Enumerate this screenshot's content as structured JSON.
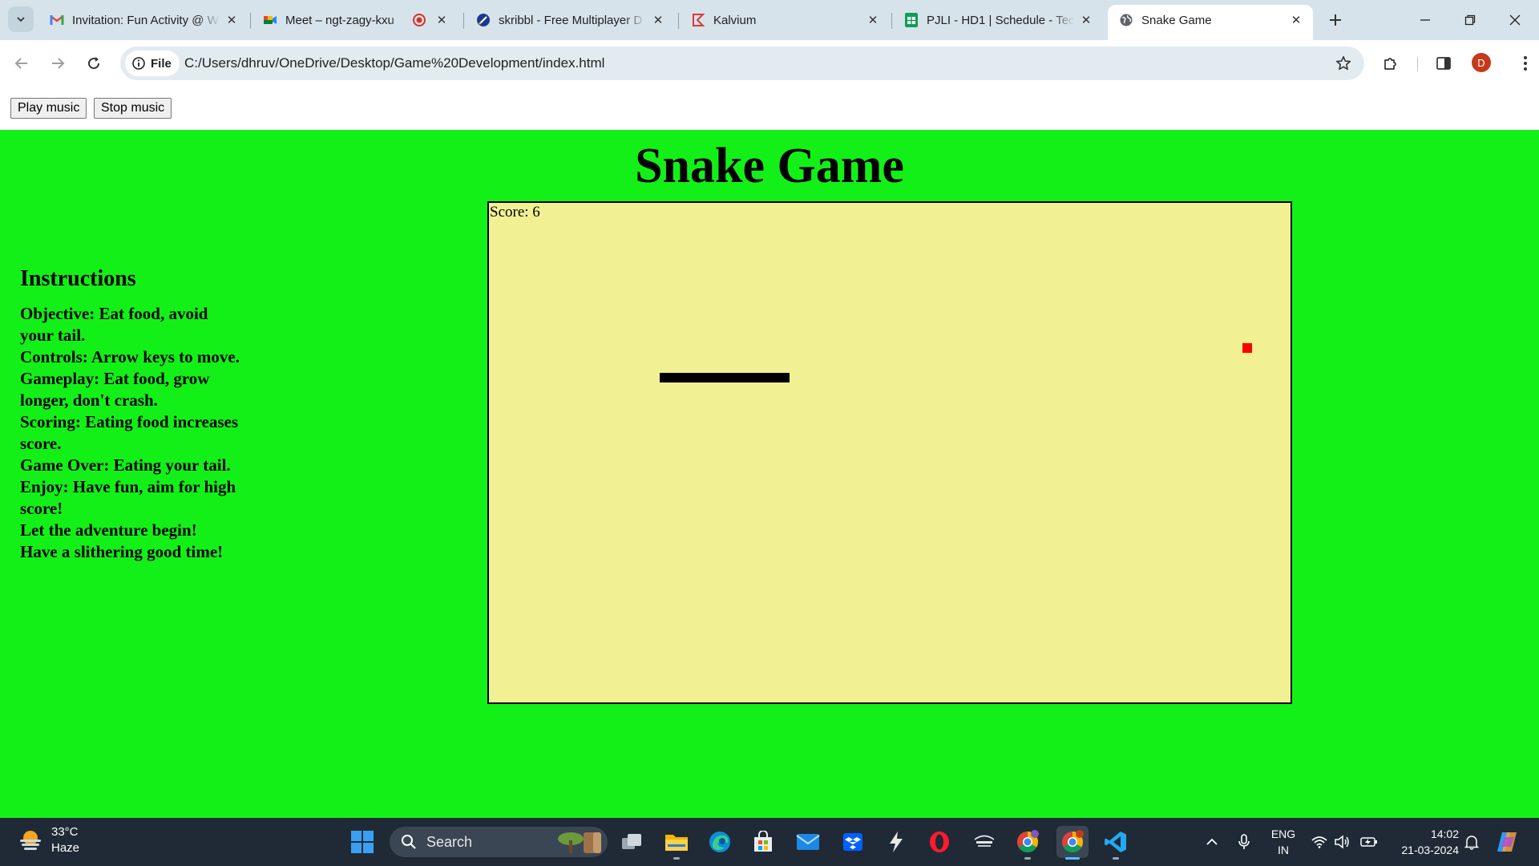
{
  "browser": {
    "tabs": [
      {
        "label": "Invitation: Fun Activity @ W",
        "icon": "gmail-icon"
      },
      {
        "label": "Meet – ngt-zagy-kxu",
        "icon": "google-meet-icon",
        "extra": "recording-icon"
      },
      {
        "label": "skribbl - Free Multiplayer D",
        "icon": "skribbl-icon"
      },
      {
        "label": "Kalvium",
        "icon": "kalvium-icon"
      },
      {
        "label": "PJLI - HD1 | Schedule - Tec",
        "icon": "google-sheets-icon"
      },
      {
        "label": "Snake Game",
        "icon": "globe-icon",
        "active": true
      }
    ],
    "address": {
      "chip_label": "File",
      "url": "C:/Users/dhruv/OneDrive/Desktop/Game%20Development/index.html"
    },
    "profile_initial": "D"
  },
  "page": {
    "buttons": {
      "play": "Play music",
      "stop": "Stop music"
    },
    "title": "Snake Game",
    "instructions": {
      "heading": "Instructions",
      "lines": [
        "Objective: Eat food, avoid your tail.",
        "Controls: Arrow keys to move.",
        "Gameplay: Eat food, grow longer, don't crash.",
        "Scoring: Eating food increases score.",
        "Game Over: Eating your tail.",
        "Enjoy: Have fun, aim for high score!",
        "Let the adventure begin!",
        "Have a slithering good time!"
      ]
    },
    "score_text": "Score: 6",
    "colors": {
      "background": "#13f018",
      "board": "#f1f093",
      "snake": "#000000",
      "food": "#ff0000"
    }
  },
  "taskbar": {
    "weather": {
      "temp": "33°C",
      "condition": "Haze"
    },
    "search_placeholder": "Search",
    "lang_top": "ENG",
    "lang_bottom": "IN",
    "time": "14:02",
    "date": "21-03-2024"
  }
}
